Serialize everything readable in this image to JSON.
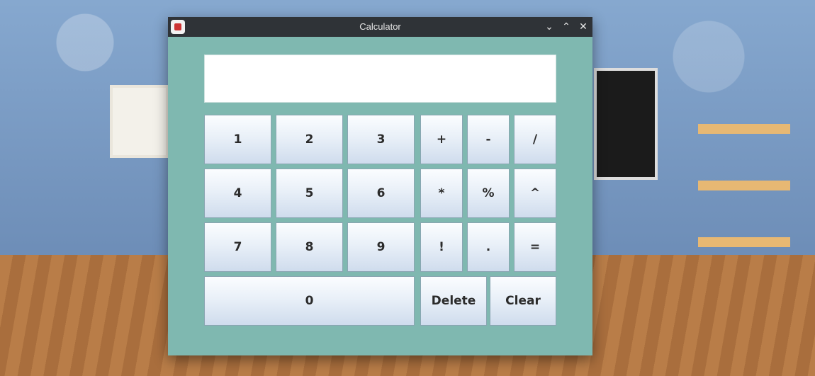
{
  "window": {
    "title": "Calculator",
    "controls": {
      "minimize": "⌄",
      "maximize": "⌃",
      "close": "✕"
    }
  },
  "display": {
    "value": ""
  },
  "keypad": {
    "k1": "1",
    "k2": "2",
    "k3": "3",
    "plus": "+",
    "minus": "-",
    "divide": "/",
    "k4": "4",
    "k5": "5",
    "k6": "6",
    "multiply": "*",
    "percent": "%",
    "power": "^",
    "k7": "7",
    "k8": "8",
    "k9": "9",
    "factorial": "!",
    "dot": ".",
    "equals": "=",
    "k0": "0",
    "delete": "Delete",
    "clear": "Clear"
  },
  "colors": {
    "window_bg": "#7fb8b0",
    "titlebar": "#2f3337",
    "button_top": "#fbfdff",
    "button_bottom": "#cfdced"
  }
}
